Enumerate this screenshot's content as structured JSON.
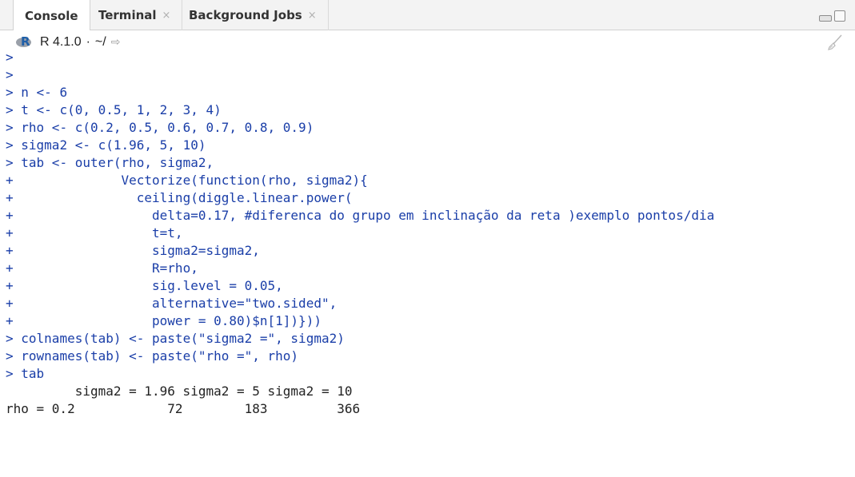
{
  "tabs": [
    {
      "label": "Console",
      "active": true,
      "closable": false
    },
    {
      "label": "Terminal",
      "active": false,
      "closable": true
    },
    {
      "label": "Background Jobs",
      "active": false,
      "closable": true
    }
  ],
  "tab_close_glyph": "×",
  "info": {
    "r_version": "R 4.1.0",
    "separator": "·",
    "path": "~/",
    "goto_glyph": "⇨"
  },
  "console": {
    "prompt": ">",
    "continuation": "+",
    "lines": [
      {
        "type": "prompt",
        "text": ""
      },
      {
        "type": "prompt",
        "text": ""
      },
      {
        "type": "prompt",
        "text": "n <- 6"
      },
      {
        "type": "prompt",
        "text": "t <- c(0, 0.5, 1, 2, 3, 4)"
      },
      {
        "type": "prompt",
        "text": "rho <- c(0.2, 0.5, 0.6, 0.7, 0.8, 0.9)"
      },
      {
        "type": "prompt",
        "text": "sigma2 <- c(1.96, 5, 10)"
      },
      {
        "type": "prompt",
        "text": "tab <- outer(rho, sigma2,"
      },
      {
        "type": "cont",
        "text": "             Vectorize(function(rho, sigma2){"
      },
      {
        "type": "cont",
        "text": "               ceiling(diggle.linear.power("
      },
      {
        "type": "cont",
        "text": "                 delta=0.17, #diferenca do grupo em inclinação da reta )exemplo pontos/dia"
      },
      {
        "type": "cont",
        "text": "                 t=t,"
      },
      {
        "type": "cont",
        "text": "                 sigma2=sigma2,"
      },
      {
        "type": "cont",
        "text": "                 R=rho,"
      },
      {
        "type": "cont",
        "text": "                 sig.level = 0.05,"
      },
      {
        "type": "cont",
        "text": "                 alternative=\"two.sided\","
      },
      {
        "type": "cont",
        "text": "                 power = 0.80)$n[1])}))"
      },
      {
        "type": "prompt",
        "text": "colnames(tab) <- paste(\"sigma2 =\", sigma2)"
      },
      {
        "type": "prompt",
        "text": "rownames(tab) <- paste(\"rho =\", rho)"
      },
      {
        "type": "prompt",
        "text": "tab"
      },
      {
        "type": "output",
        "text": "         sigma2 = 1.96 sigma2 = 5 sigma2 = 10"
      },
      {
        "type": "output",
        "text": "rho = 0.2            72        183         366"
      }
    ]
  },
  "colors": {
    "prompt_blue": "#1a3ea8",
    "output_text": "#222222",
    "tab_bar_bg": "#f3f3f3"
  },
  "icons": {
    "r_logo": "r-logo-icon",
    "goto_dir": "goto-directory-icon",
    "clear": "broom-icon",
    "minimize": "minimize-icon",
    "maximize": "maximize-icon"
  }
}
